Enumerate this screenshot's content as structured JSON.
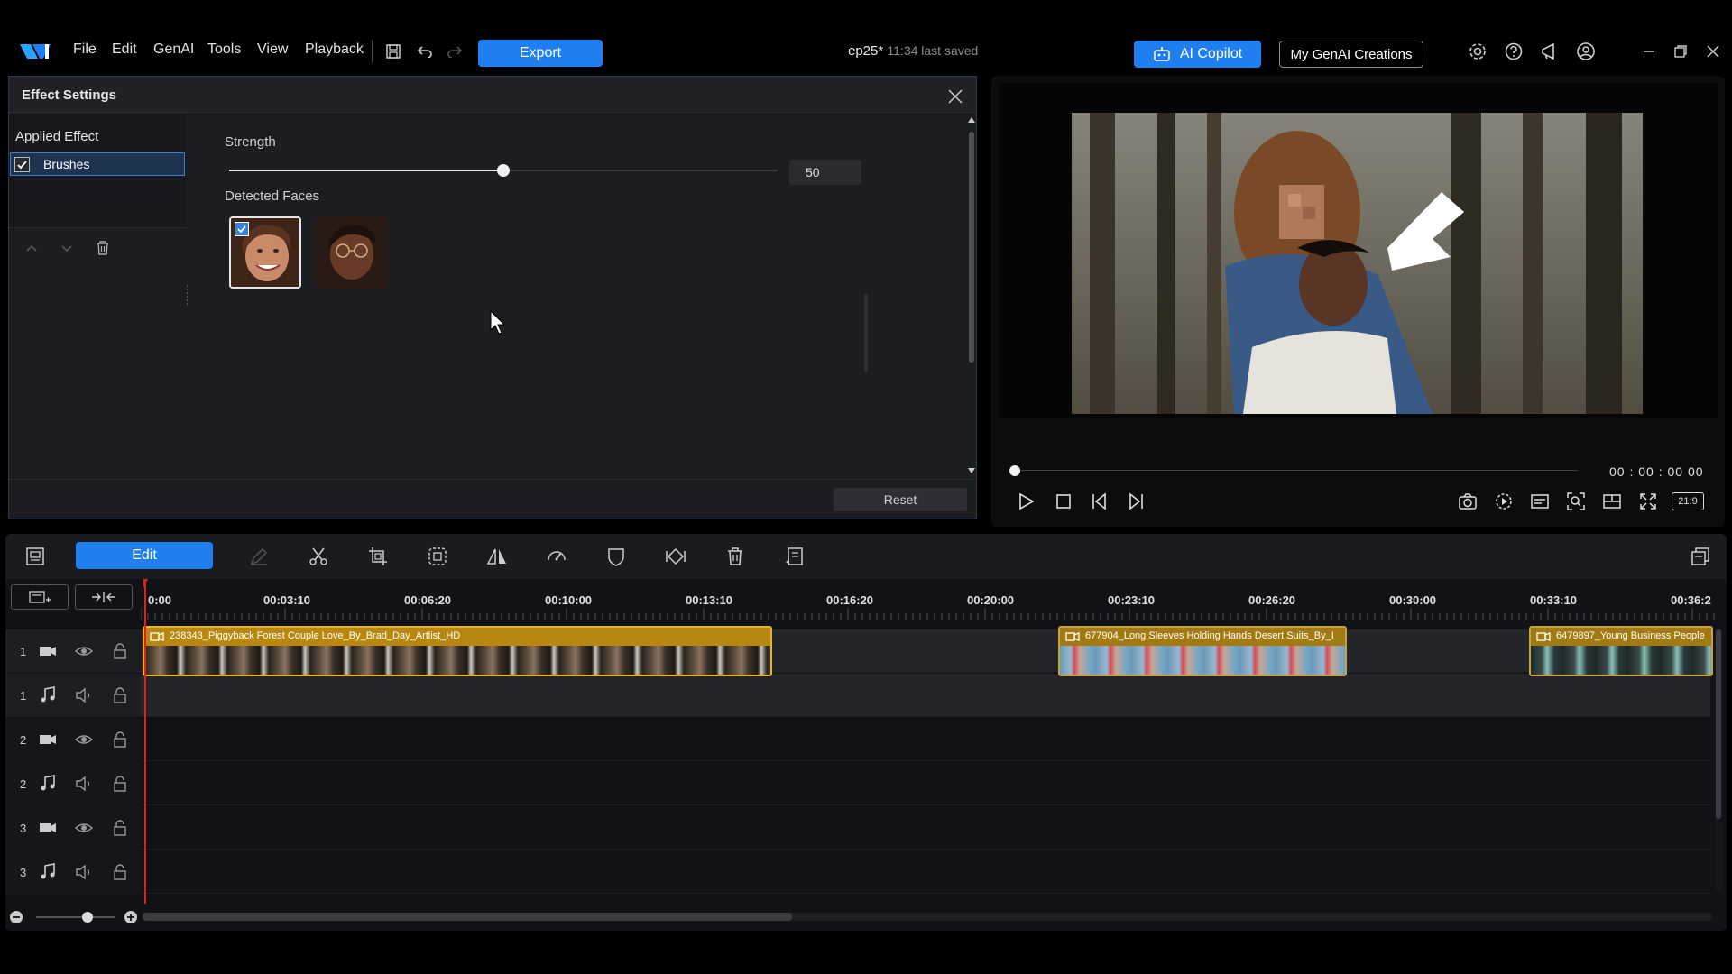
{
  "app": {
    "menu": [
      "File",
      "Edit",
      "GenAI",
      "Tools",
      "View",
      "Playback"
    ],
    "export_label": "Export",
    "project_name": "ep25*",
    "save_status": "11:34 last saved",
    "ai_copilot_label": "AI Copilot",
    "genai_creations_label": "My GenAI Creations"
  },
  "effect_settings": {
    "title": "Effect Settings",
    "applied_effect_label": "Applied Effect",
    "effect_item": "Brushes",
    "strength_label": "Strength",
    "strength_value": "50",
    "strength_fraction": 0.5,
    "detected_faces_label": "Detected Faces",
    "reset_label": "Reset"
  },
  "preview": {
    "timecode": "00 : 00 : 00  00",
    "aspect_ratio": "21:9"
  },
  "timeline": {
    "edit_label": "Edit",
    "ruler": [
      "0:00",
      "00:03:10",
      "00:06:20",
      "00:10:00",
      "00:13:10",
      "00:16:20",
      "00:20:00",
      "00:23:10",
      "00:26:20",
      "00:30:00",
      "00:33:10",
      "00:36:2"
    ],
    "tracks": [
      {
        "num": "1",
        "type": "video"
      },
      {
        "num": "1",
        "type": "audio"
      },
      {
        "num": "2",
        "type": "video"
      },
      {
        "num": "2",
        "type": "audio"
      },
      {
        "num": "3",
        "type": "video"
      },
      {
        "num": "3",
        "type": "audio"
      }
    ],
    "clips": [
      {
        "title": "238343_Piggyback Forest Couple Love_By_Brad_Day_Artlist_HD"
      },
      {
        "title": "677904_Long Sleeves Holding Hands Desert Suits_By_I"
      },
      {
        "title": "6479897_Young Business People"
      }
    ]
  },
  "colors": {
    "accent": "#1f7ff0",
    "clip_border": "#e6b42a",
    "playhead": "#e02020"
  }
}
